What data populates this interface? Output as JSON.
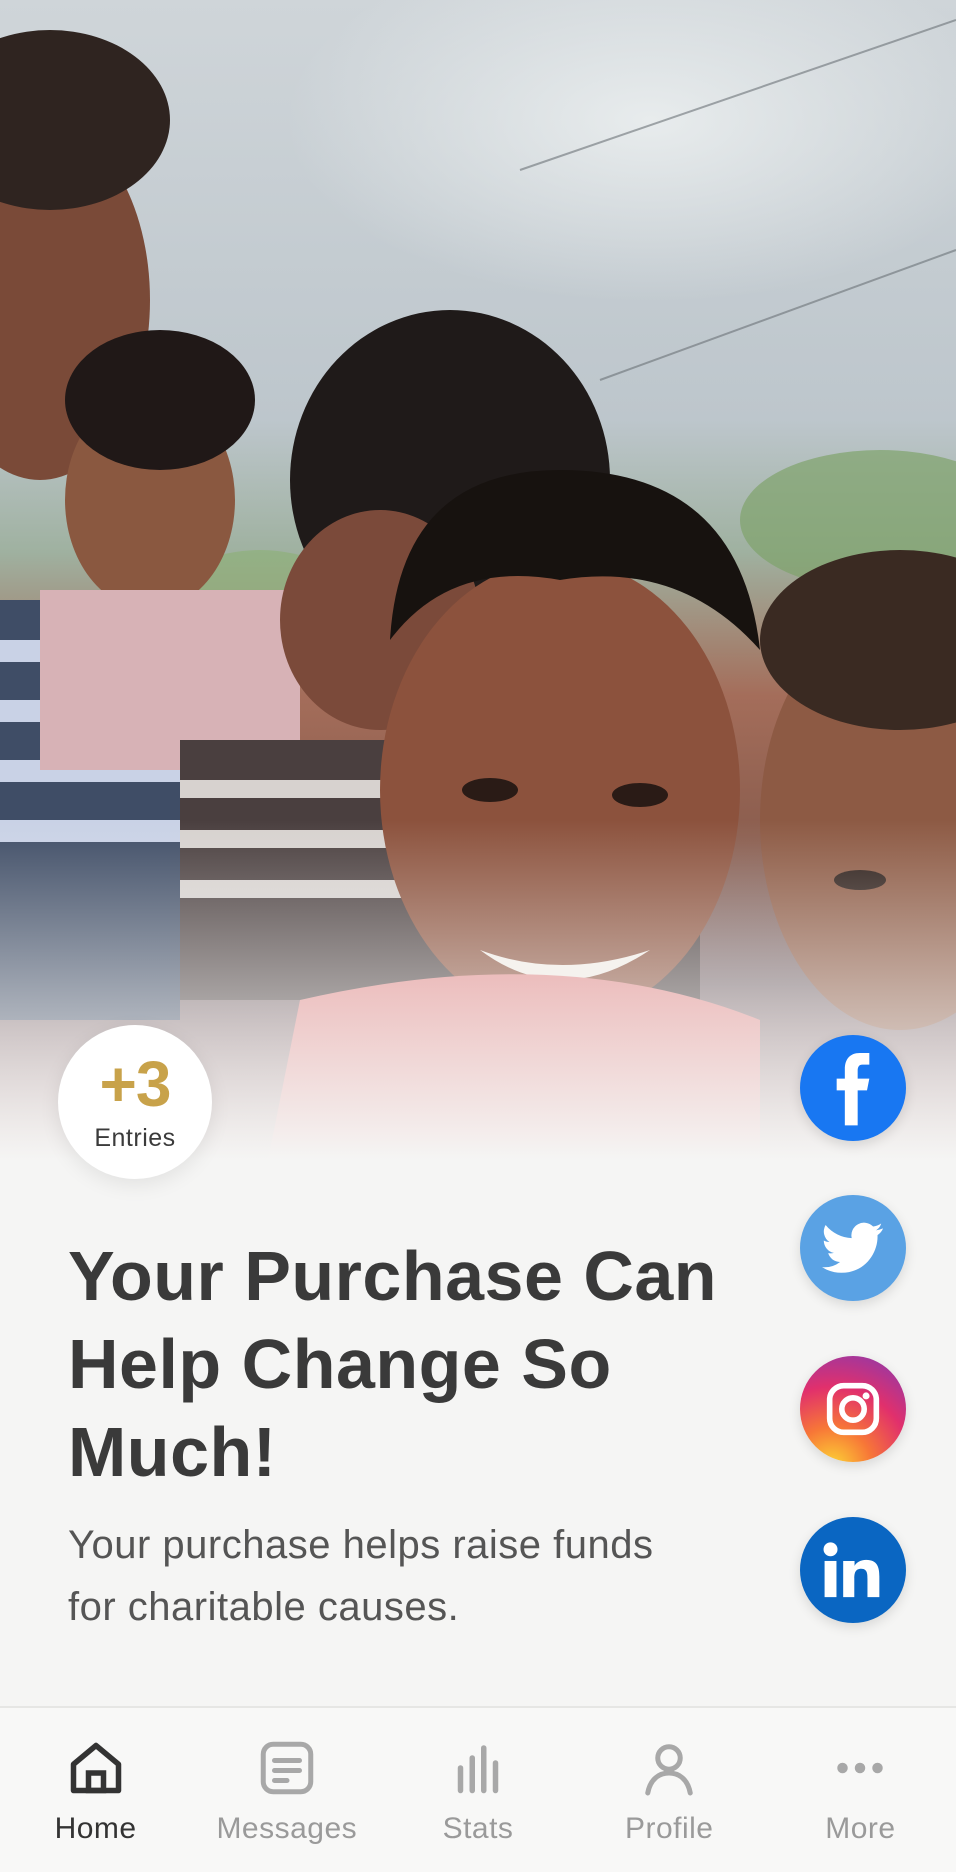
{
  "badge": {
    "value": "+3",
    "label": "Entries"
  },
  "headline": "Your Purchase Can Help Change So Much!",
  "subtext": "Your purchase helps raise funds for charitable causes.",
  "social": [
    {
      "name": "facebook-icon",
      "color": "#1877f2"
    },
    {
      "name": "twitter-icon",
      "color": "#5aa2e4"
    },
    {
      "name": "instagram-icon",
      "color": "#e1306c"
    },
    {
      "name": "linkedin-icon",
      "color": "#0a66c2"
    }
  ],
  "tabs": [
    {
      "label": "Home",
      "icon": "home-icon",
      "active": true
    },
    {
      "label": "Messages",
      "icon": "messages-icon",
      "active": false
    },
    {
      "label": "Stats",
      "icon": "stats-icon",
      "active": false
    },
    {
      "label": "Profile",
      "icon": "profile-icon",
      "active": false
    },
    {
      "label": "More",
      "icon": "more-icon",
      "active": false
    }
  ],
  "colors": {
    "accent_gold": "#c8a24a",
    "text_dark": "#3a3a3a",
    "tab_inactive": "#9a9a9a"
  }
}
